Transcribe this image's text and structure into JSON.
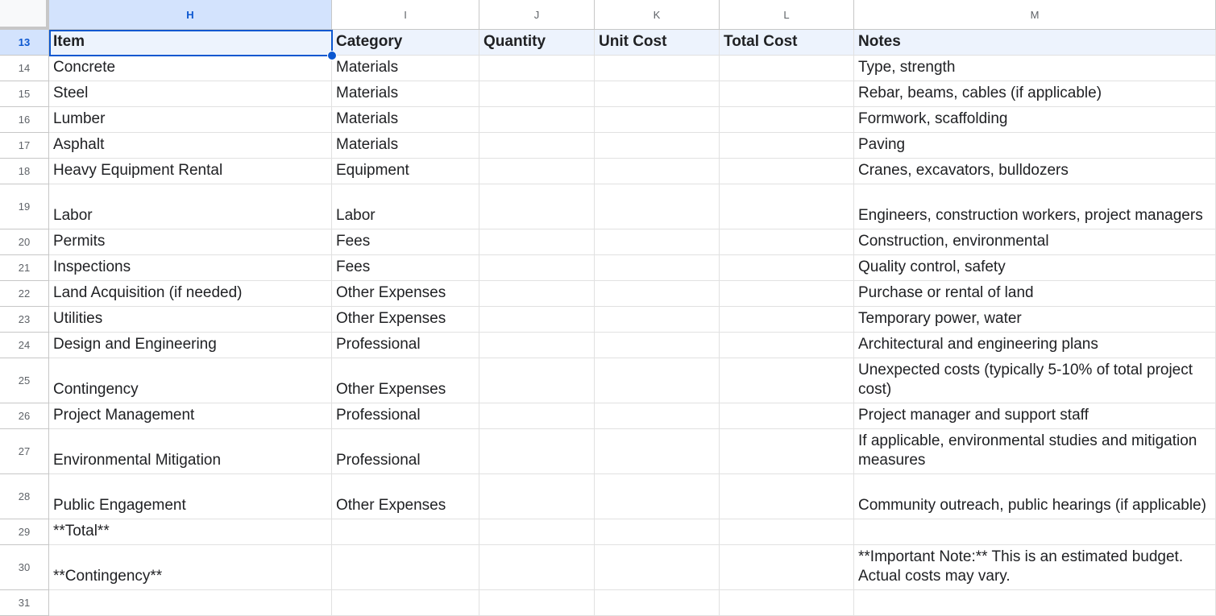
{
  "columns": [
    {
      "letter": "H",
      "selected": true
    },
    {
      "letter": "I",
      "selected": false
    },
    {
      "letter": "J",
      "selected": false
    },
    {
      "letter": "K",
      "selected": false
    },
    {
      "letter": "L",
      "selected": false
    },
    {
      "letter": "M",
      "selected": false
    }
  ],
  "selected_cell": "H13",
  "header_row": {
    "number": "13",
    "cells": [
      "Item",
      "Category",
      "Quantity",
      "Unit Cost",
      "Total Cost",
      "Notes"
    ]
  },
  "rows": [
    {
      "number": "14",
      "cells": [
        "Concrete",
        "Materials",
        "",
        "",
        "",
        "Type, strength"
      ]
    },
    {
      "number": "15",
      "cells": [
        "Steel",
        "Materials",
        "",
        "",
        "",
        "Rebar, beams, cables (if applicable)"
      ]
    },
    {
      "number": "16",
      "cells": [
        "Lumber",
        "Materials",
        "",
        "",
        "",
        "Formwork, scaffolding"
      ]
    },
    {
      "number": "17",
      "cells": [
        "Asphalt",
        "Materials",
        "",
        "",
        "",
        "Paving"
      ]
    },
    {
      "number": "18",
      "cells": [
        "Heavy Equipment Rental",
        "Equipment",
        "",
        "",
        "",
        "Cranes, excavators, bulldozers"
      ]
    },
    {
      "number": "19",
      "tall": true,
      "cells": [
        "Labor",
        "Labor",
        "",
        "",
        "",
        "Engineers, construction workers, project managers"
      ]
    },
    {
      "number": "20",
      "cells": [
        "Permits",
        "Fees",
        "",
        "",
        "",
        "Construction, environmental"
      ]
    },
    {
      "number": "21",
      "cells": [
        "Inspections",
        "Fees",
        "",
        "",
        "",
        "Quality control, safety"
      ]
    },
    {
      "number": "22",
      "cells": [
        "Land Acquisition (if needed)",
        "Other Expenses",
        "",
        "",
        "",
        "Purchase or rental of land"
      ]
    },
    {
      "number": "23",
      "cells": [
        "Utilities",
        "Other Expenses",
        "",
        "",
        "",
        "Temporary power, water"
      ]
    },
    {
      "number": "24",
      "cells": [
        "Design and Engineering",
        "Professional",
        "",
        "",
        "",
        "Architectural and engineering plans"
      ]
    },
    {
      "number": "25",
      "tall": true,
      "cells": [
        "Contingency",
        "Other Expenses",
        "",
        "",
        "",
        "Unexpected costs (typically 5-10% of total project cost)"
      ]
    },
    {
      "number": "26",
      "cells": [
        "Project Management",
        "Professional",
        "",
        "",
        "",
        "Project manager and support staff"
      ]
    },
    {
      "number": "27",
      "tall": true,
      "cells": [
        "Environmental Mitigation",
        "Professional",
        "",
        "",
        "",
        "If applicable, environmental studies and mitigation measures"
      ]
    },
    {
      "number": "28",
      "tall": true,
      "cells": [
        "Public Engagement",
        "Other Expenses",
        "",
        "",
        "",
        "Community outreach, public hearings (if applicable)"
      ]
    },
    {
      "number": "29",
      "cells": [
        "**Total**",
        "",
        "",
        "",
        "",
        ""
      ]
    },
    {
      "number": "30",
      "tall": true,
      "cells": [
        "**Contingency**",
        "",
        "",
        "",
        "",
        "**Important Note:** This is an estimated budget. Actual costs may vary."
      ]
    },
    {
      "number": "31",
      "cells": [
        "",
        "",
        "",
        "",
        "",
        ""
      ]
    }
  ],
  "colors": {
    "selection": "#0b57d0",
    "header_fill": "#edf3fd",
    "selected_header_fill": "#d3e3fd",
    "gridline": "#e1e1e1"
  }
}
